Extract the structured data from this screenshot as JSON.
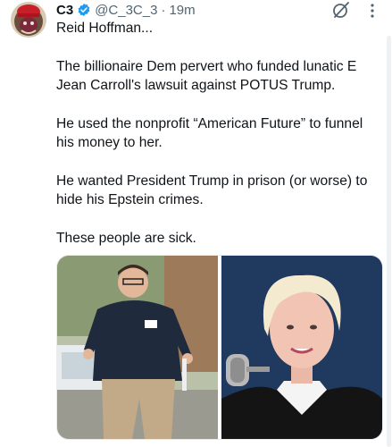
{
  "tweet": {
    "author_name": "C3",
    "handle": "@C_3C_3",
    "separator": "·",
    "time": "19m",
    "paragraphs": [
      "Reid Hoffman...",
      "The billionaire Dem pervert who funded lunatic E Jean Carroll's lawsuit against POTUS Trump.",
      "He used the nonprofit “American Future” to funnel his money to her.",
      "He wanted President Trump in prison (or worse) to hide his Epstein crimes.",
      "These people are sick."
    ]
  },
  "icons": {
    "verified": "verified-badge-icon",
    "grok": "grok-icon",
    "more": "more-vertical-icon"
  },
  "colors": {
    "verified_blue": "#1d9bf0",
    "secondary_text": "#536471",
    "primary_text": "#0f1419"
  }
}
